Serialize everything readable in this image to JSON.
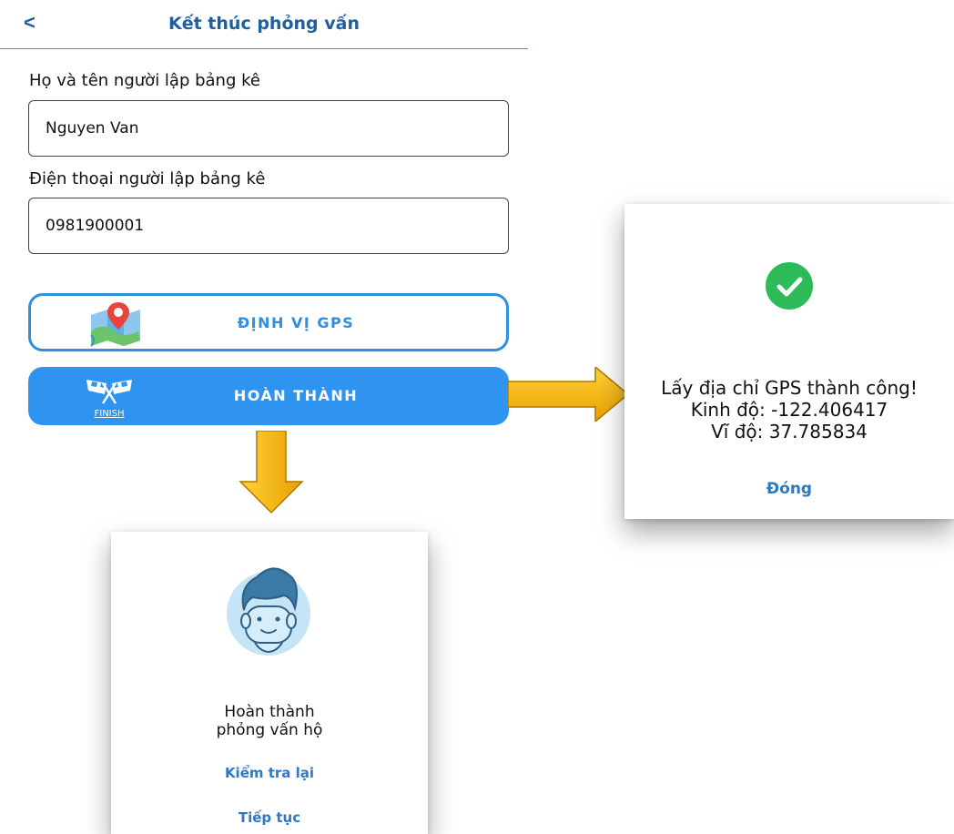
{
  "header": {
    "back_glyph": "<",
    "title": "Kết thúc phỏng vấn"
  },
  "form": {
    "name_label": "Họ và tên người lập bảng kê",
    "name_value": "Nguyen Van",
    "phone_label": "Điện thoại người lập bảng kê",
    "phone_value": "0981900001"
  },
  "buttons": {
    "gps_label": "ĐỊNH VỊ GPS",
    "gps_icon": "map-pin-icon",
    "finish_label": "HOÀN THÀNH",
    "finish_icon": "finish-flag-icon",
    "finish_icon_text": "FINISH"
  },
  "gps_dialog": {
    "icon": "check-circle-icon",
    "message_line1": "Lấy địa chỉ GPS thành công!",
    "message_line2": "Kinh độ: -122.406417",
    "message_line3": "Vĩ độ: 37.785834",
    "close_label": "Đóng"
  },
  "done_dialog": {
    "icon": "avatar-face-icon",
    "message_line1": "Hoàn thành",
    "message_line2": "phỏng vấn hộ",
    "recheck_label": "Kiểm tra lại",
    "continue_label": "Tiếp tục"
  },
  "colors": {
    "primary": "#2f94ef",
    "title_blue": "#1e5fa0",
    "link_blue": "#2f78c4",
    "success_green": "#2dbb5a",
    "arrow_yellow": "#f5b400"
  }
}
